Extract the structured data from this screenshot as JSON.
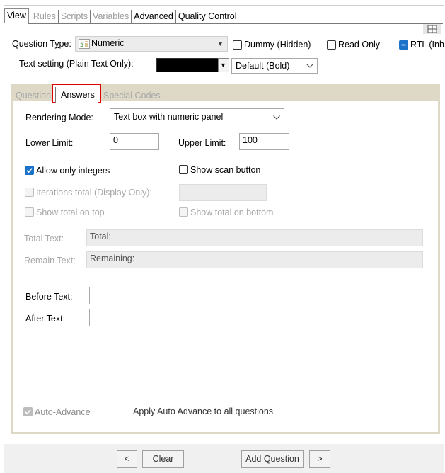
{
  "top_tabs": [
    {
      "label": "View",
      "state": "active"
    },
    {
      "label": "Rules",
      "state": "disabled"
    },
    {
      "label": "Scripts",
      "state": "disabled"
    },
    {
      "label": "Variables",
      "state": "disabled"
    },
    {
      "label": "Advanced",
      "state": "enabled"
    },
    {
      "label": "Quality Control",
      "state": "enabled"
    }
  ],
  "question_type": {
    "label": "Question Type:",
    "value": "Numeric"
  },
  "header_checks": {
    "dummy": "Dummy (Hidden)",
    "read_only": "Read Only",
    "rtl": "RTL (Inh"
  },
  "text_setting": {
    "label": "Text setting (Plain Text Only):",
    "color": "#000000",
    "font_value": "Default (Bold)"
  },
  "inner_tabs": [
    {
      "label": "Question",
      "state": "disabled"
    },
    {
      "label": "Answers",
      "state": "active"
    },
    {
      "label": "Special Codes",
      "state": "disabled"
    }
  ],
  "highlight_color": "#e00000",
  "answers": {
    "rendering_mode_label": "Rendering Mode:",
    "rendering_mode_value": "Text box with numeric panel",
    "lower_limit_label": "Lower Limit:",
    "lower_limit_value": "0",
    "upper_limit_label": "Upper Limit:",
    "upper_limit_value": "100",
    "allow_integers": "Allow only integers",
    "show_scan": "Show scan button",
    "iterations_total": "Iterations total (Display Only):",
    "show_total_top": "Show total on top",
    "show_total_bottom": "Show total on bottom",
    "total_text_label": "Total Text:",
    "total_text_value": "Total:",
    "remain_text_label": "Remain Text:",
    "remain_text_value": "Remaining:",
    "before_text_label": "Before Text:",
    "after_text_label": "After Text:",
    "auto_advance": "Auto-Advance",
    "apply_auto_advance": "Apply Auto Advance to all questions"
  },
  "footer": {
    "prev": "<",
    "clear": "Clear",
    "add_question": "Add Question",
    "next": ">"
  }
}
